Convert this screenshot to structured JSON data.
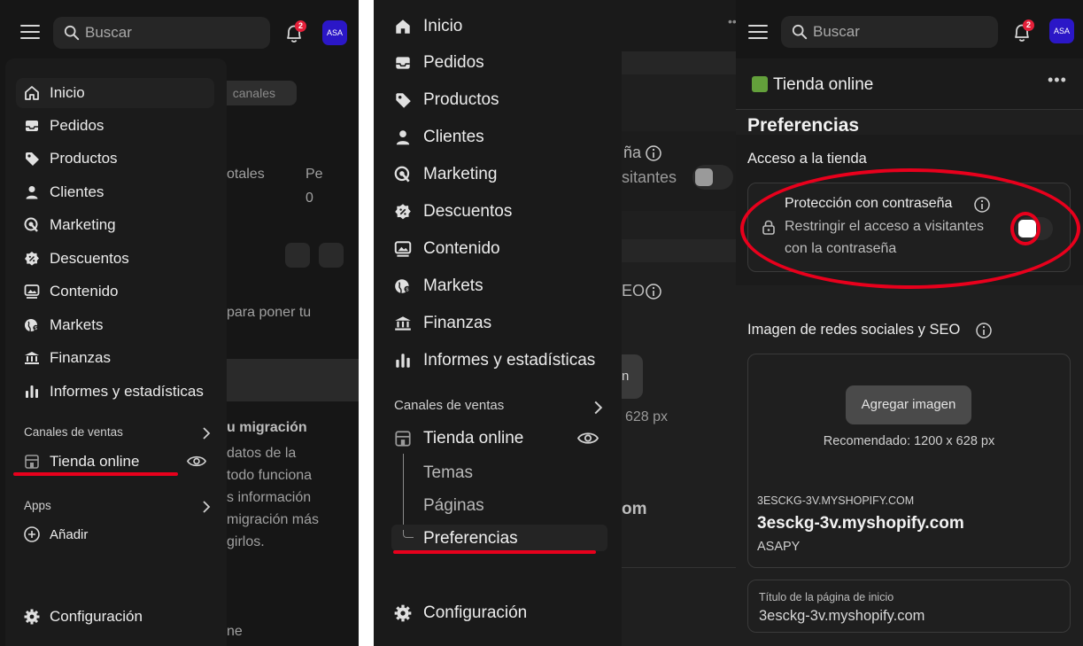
{
  "search": {
    "placeholder": "Buscar"
  },
  "notifications": {
    "count": "2"
  },
  "avatar": {
    "initials": "ASA"
  },
  "colors": {
    "accent_red": "#e8001c",
    "avatar_bg": "#2b17c7",
    "badge_red": "#e5203a"
  },
  "panel1": {
    "background": {
      "pill": "canales",
      "col1": "otales",
      "col2": "Pe",
      "col2_value": "0",
      "hint": "para poner tu",
      "migration_title": "u migración",
      "migration_lines": [
        "datos de la",
        "todo funciona",
        "s información",
        "migración más",
        "girlos."
      ],
      "bottom": "ne"
    },
    "menu": {
      "items": [
        {
          "label": "Inicio",
          "icon": "home-icon"
        },
        {
          "label": "Pedidos",
          "icon": "inbox-icon"
        },
        {
          "label": "Productos",
          "icon": "tag-icon"
        },
        {
          "label": "Clientes",
          "icon": "person-icon"
        },
        {
          "label": "Marketing",
          "icon": "target-icon"
        },
        {
          "label": "Descuentos",
          "icon": "discount-icon"
        },
        {
          "label": "Contenido",
          "icon": "image-icon"
        },
        {
          "label": "Markets",
          "icon": "globe-icon"
        },
        {
          "label": "Finanzas",
          "icon": "bank-icon"
        },
        {
          "label": "Informes y estadísticas",
          "icon": "bar-chart-icon"
        }
      ],
      "sales_channels": "Canales de ventas",
      "online_store": "Tienda online",
      "apps": "Apps",
      "add": "Añadir",
      "settings": "Configuración"
    }
  },
  "panel2": {
    "menu": {
      "items": [
        {
          "label": "Inicio",
          "icon": "home-icon"
        },
        {
          "label": "Pedidos",
          "icon": "inbox-icon"
        },
        {
          "label": "Productos",
          "icon": "tag-icon"
        },
        {
          "label": "Clientes",
          "icon": "person-icon"
        },
        {
          "label": "Marketing",
          "icon": "target-icon"
        },
        {
          "label": "Descuentos",
          "icon": "discount-icon"
        },
        {
          "label": "Contenido",
          "icon": "image-icon"
        },
        {
          "label": "Markets",
          "icon": "globe-icon"
        },
        {
          "label": "Finanzas",
          "icon": "bank-icon"
        },
        {
          "label": "Informes y estadísticas",
          "icon": "bar-chart-icon"
        }
      ],
      "sales_channels": "Canales de ventas",
      "online_store": "Tienda online",
      "themes": "Temas",
      "pages": "Páginas",
      "preferences": "Preferencias",
      "settings": "Configuración"
    },
    "background": {
      "password_fragment": "ña",
      "visitors_fragment": "sitantes",
      "seo_fragment": "EO",
      "button_fragment": "n",
      "size_fragment": "628 px",
      "domain_fragment": "om"
    }
  },
  "panel3": {
    "store_title": "Tienda online",
    "page_title": "Preferencias",
    "access_section": "Acceso a la tienda",
    "password_protection": "Protección con contraseña",
    "password_desc": [
      "Restringir el acceso a visitantes",
      "con la contraseña"
    ],
    "seo_section": "Imagen de redes sociales y SEO",
    "add_image": "Agregar imagen",
    "recommended": "Recomendado: 1200 x 628 px",
    "preview_domain_upper": "3ESCKG-3V.MYSHOPIFY.COM",
    "preview_domain": "3esckg-3v.myshopify.com",
    "preview_name": "ASAPY",
    "home_title_label": "Título de la página de inicio",
    "home_title_value": "3esckg-3v.myshopify.com"
  }
}
